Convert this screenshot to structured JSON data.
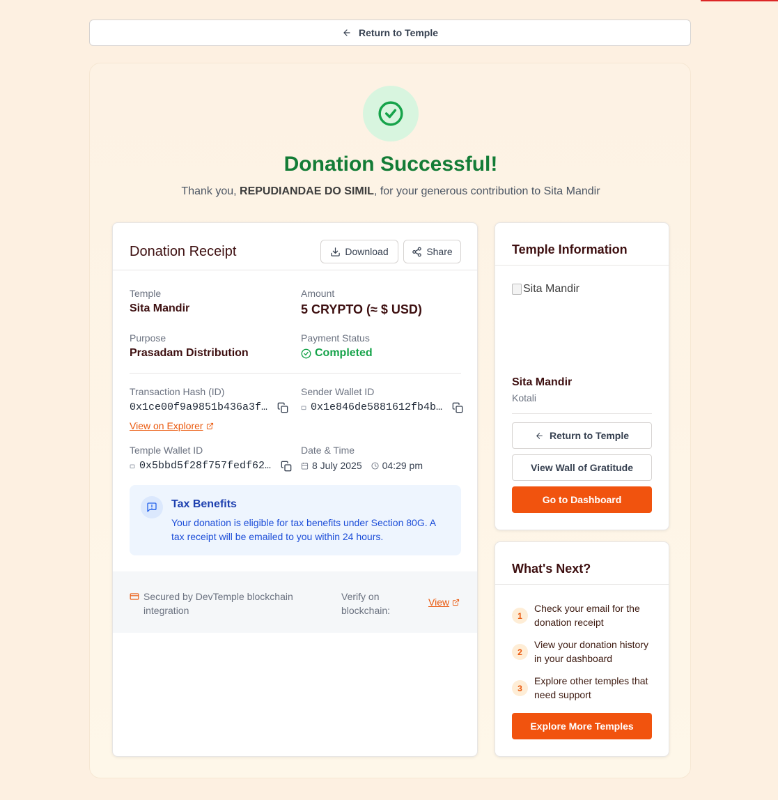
{
  "top_nav": {
    "return_label": "Return to Temple"
  },
  "hero": {
    "title": "Donation Successful!",
    "subtitle_prefix": "Thank you, ",
    "donor_name": "REPUDIANDAE DO SIMIL",
    "subtitle_suffix": ", for your generous contribution to Sita Mandir"
  },
  "receipt": {
    "title": "Donation Receipt",
    "download_label": "Download",
    "share_label": "Share",
    "temple_label": "Temple",
    "temple_value": "Sita Mandir",
    "amount_label": "Amount",
    "amount_value": "5 CRYPTO (≈ $ USD)",
    "purpose_label": "Purpose",
    "purpose_value": "Prasadam Distribution",
    "status_label": "Payment Status",
    "status_value": "Completed",
    "tx_label": "Transaction Hash (ID)",
    "tx_value": "0x1ce00f9a9851b436a3f…",
    "explorer_link": "View on Explorer",
    "sender_label": "Sender Wallet ID",
    "sender_value": "0x1e846de5881612fb4b…",
    "temple_wallet_label": "Temple Wallet ID",
    "temple_wallet_value": "0x5bbd5f28f757fedf62…",
    "datetime_label": "Date & Time",
    "date_value": "8 July 2025",
    "time_value": "04:29 pm",
    "tax": {
      "title": "Tax Benefits",
      "text": "Your donation is eligible for tax benefits under Section 80G. A tax receipt will be emailed to you within 24 hours."
    },
    "footer": {
      "secured_text": "Secured by DevTemple blockchain integration",
      "verify_label": "Verify on blockchain:",
      "view_link": "View"
    }
  },
  "temple_info": {
    "title": "Temple Information",
    "image_alt": "Sita Mandir",
    "name": "Sita Mandir",
    "location": "Kotali",
    "return_label": "Return to Temple",
    "wall_label": "View Wall of Gratitude",
    "dashboard_label": "Go to Dashboard"
  },
  "whats_next": {
    "title": "What's Next?",
    "steps": [
      {
        "num": "1",
        "text": "Check your email for the donation receipt"
      },
      {
        "num": "2",
        "text": "View your donation history in your dashboard"
      },
      {
        "num": "3",
        "text": "Explore other temples that need support"
      }
    ],
    "explore_label": "Explore More Temples"
  },
  "colors": {
    "accent": "#f1530e",
    "success": "#137c36",
    "background": "#fdf0e1",
    "info_blue": "#1e40af"
  },
  "icons": [
    "arrow-left-icon",
    "check-circle-icon",
    "download-icon",
    "share-icon",
    "copy-icon",
    "external-link-icon",
    "calendar-icon",
    "clock-icon",
    "message-alert-icon",
    "credit-card-icon"
  ]
}
